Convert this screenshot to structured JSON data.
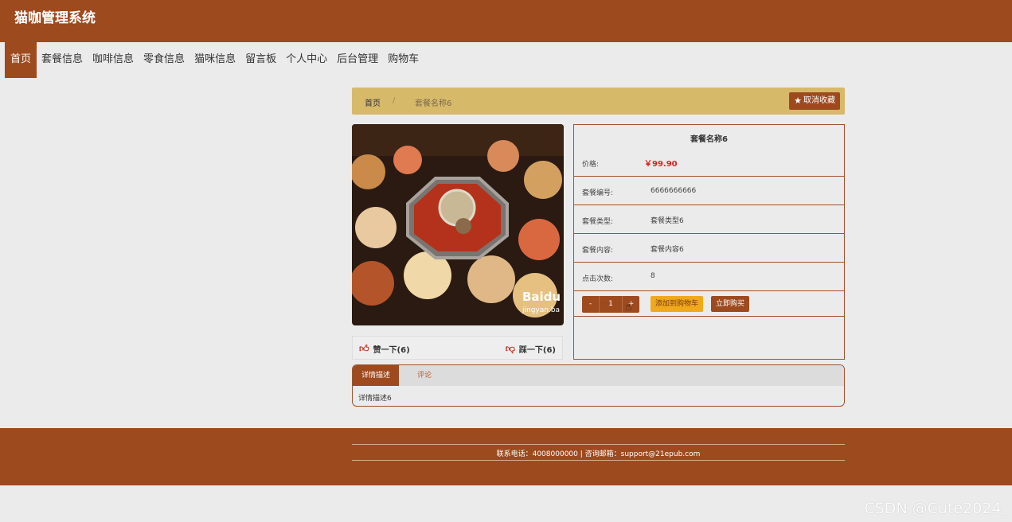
{
  "app": {
    "title": "猫咖管理系统"
  },
  "nav": {
    "items": [
      "首页",
      "套餐信息",
      "咖啡信息",
      "零食信息",
      "猫咪信息",
      "留言板",
      "个人中心",
      "后台管理",
      "购物车"
    ],
    "active_index": 0
  },
  "breadcrumb": {
    "home": "首页",
    "separator": "/",
    "current": "套餐名称6"
  },
  "favorite_button": {
    "label": "取消收藏",
    "icon": "star-icon"
  },
  "product": {
    "image_watermark": "Baidu jingyan.baidu",
    "name": "套餐名称6",
    "price_label": "价格:",
    "price": "￥99.90",
    "rows": [
      {
        "label": "套餐编号:",
        "value": "6666666666"
      },
      {
        "label": "套餐类型:",
        "value": "套餐类型6"
      },
      {
        "label": "套餐内容:",
        "value": "套餐内容6"
      },
      {
        "label": "点击次数:",
        "value": "8"
      }
    ]
  },
  "quantity": {
    "minus": "-",
    "value": "1",
    "plus": "+"
  },
  "actions": {
    "add_to_cart": "添加到购物车",
    "buy_now": "立即购买"
  },
  "votes": {
    "up": "赞一下(6)",
    "down": "踩一下(6)"
  },
  "tabs": {
    "items": [
      "详情描述",
      "评论"
    ],
    "active_index": 0,
    "content": "详情描述6"
  },
  "footer": {
    "text": "联系电话：4008000000 | 咨询邮箱：support@21epub.com"
  },
  "watermark": "CSDN @Cute2024_",
  "colors": {
    "primary": "#9e4a1f",
    "breadcrumb_bg": "#d7b96a",
    "cart_button": "#f0a81c",
    "price": "#e02020",
    "page_bg": "#ebebeb"
  }
}
